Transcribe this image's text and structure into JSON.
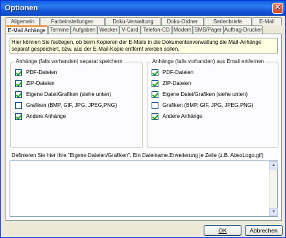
{
  "window": {
    "title": "Optionen"
  },
  "tabs": {
    "row1": [
      "Allgemein",
      "Farbeinstellungen",
      "Doku-Verwaltung",
      "Doku-Ordner",
      "Serienbriefe",
      "E-Mail"
    ],
    "row2": [
      "E-Mail Anhänge",
      "Termine",
      "Aufgaben",
      "Wecker",
      "V-Card",
      "Telefon-CD",
      "Modem",
      "SMS/Pager",
      "Auftrag-Drucken"
    ],
    "active": "E-Mail Anhänge"
  },
  "info_text": "Hier können Sie festlegen, ob beim Kopieren der E-Mails in die Dokumentenverwaltung die Mail-Anhänge separat gespeichert, bzw. aus der E-Mail-Kopie entfernt werden sollen.",
  "group_left": {
    "title": "Anhänge (falls vorhanden) separat speichern",
    "items": [
      {
        "label": "PDF-Dateien",
        "checked": true
      },
      {
        "label": "ZIP-Dateien",
        "checked": true
      },
      {
        "label": "Eigene Datei/Grafiken (siehe unten)",
        "checked": true
      },
      {
        "label": "Grafiken (BMP, GIF, JPG, JPEG,PNG)",
        "checked": false
      },
      {
        "label": "Andere Anhänge",
        "checked": true
      }
    ]
  },
  "group_right": {
    "title": "Anhänge (falls vorhanden) aus Email entfernen",
    "items": [
      {
        "label": "PDF-Dateien",
        "checked": true
      },
      {
        "label": "ZIP-Dateien",
        "checked": true
      },
      {
        "label": "Eigene Datei/Grafiken (siehe unten)",
        "checked": true
      },
      {
        "label": "Grafiken (BMP, GIF, JPG, JPEG,PNG)",
        "checked": false
      },
      {
        "label": "Andere Anhänge",
        "checked": true
      }
    ]
  },
  "definition_label": "Definieren Sie hier Ihre \"Eigene Dateien/Grafiken\". Ein Dateiname.Erweiterung je Zeile (z.B. AbexLogo.gif)",
  "definition_value": "",
  "buttons": {
    "ok": "OK",
    "cancel": "Abbrechen"
  },
  "icons": {
    "close": "close-icon",
    "check": "check-icon"
  }
}
